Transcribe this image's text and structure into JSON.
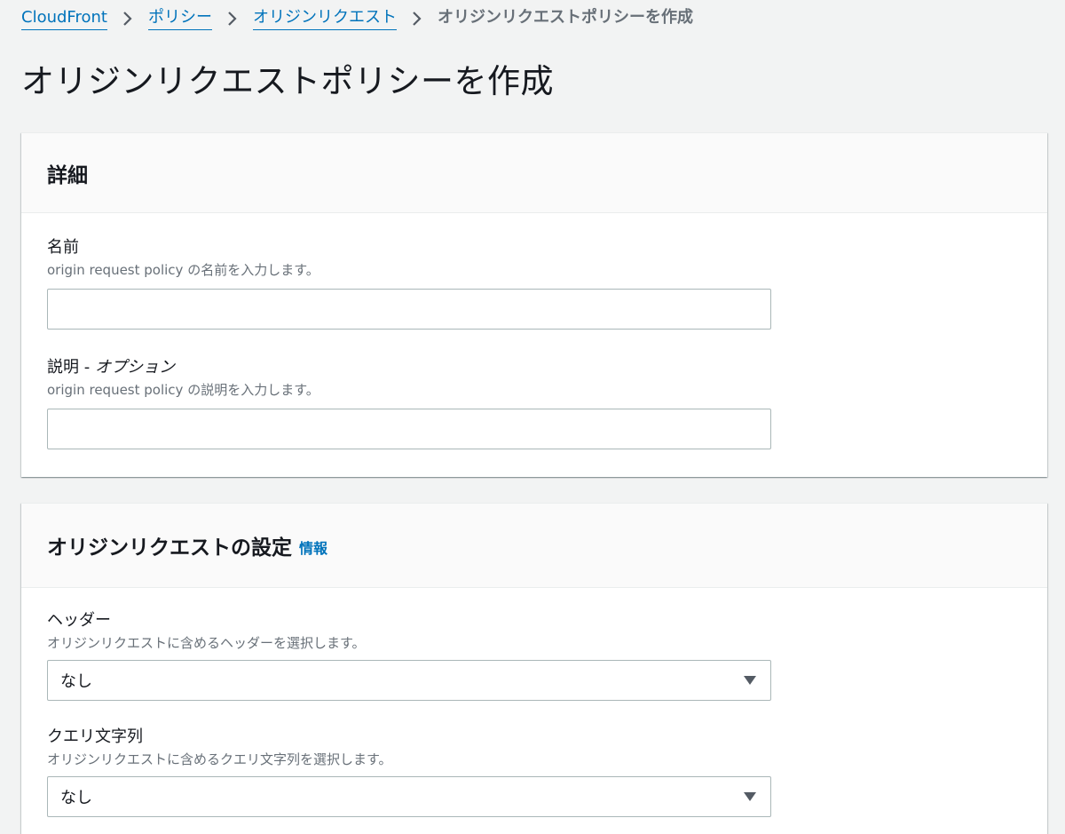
{
  "breadcrumb": {
    "items": [
      {
        "label": "CloudFront"
      },
      {
        "label": "ポリシー"
      },
      {
        "label": "オリジンリクエスト"
      }
    ],
    "current": "オリジンリクエストポリシーを作成"
  },
  "page": {
    "title": "オリジンリクエストポリシーを作成"
  },
  "details_panel": {
    "title": "詳細",
    "name_field": {
      "label": "名前",
      "description": "origin request policy の名前を入力します。",
      "value": "",
      "placeholder": ""
    },
    "description_field": {
      "label": "説明 - ",
      "label_optional": "オプション",
      "description": "origin request policy の説明を入力します。",
      "value": "",
      "placeholder": ""
    }
  },
  "settings_panel": {
    "title": "オリジンリクエストの設定",
    "info_link": "情報",
    "headers_field": {
      "label": "ヘッダー",
      "description": "オリジンリクエストに含めるヘッダーを選択します。",
      "selected": "なし"
    },
    "query_field": {
      "label": "クエリ文字列",
      "description": "オリジンリクエストに含めるクエリ文字列を選択します。",
      "selected": "なし"
    }
  },
  "icons": {
    "breadcrumb_separator": "chevron-right-icon",
    "select_caret": "caret-down-icon"
  },
  "colors": {
    "link": "#0073bb",
    "background": "#f2f3f3",
    "muted_text": "#687078"
  }
}
